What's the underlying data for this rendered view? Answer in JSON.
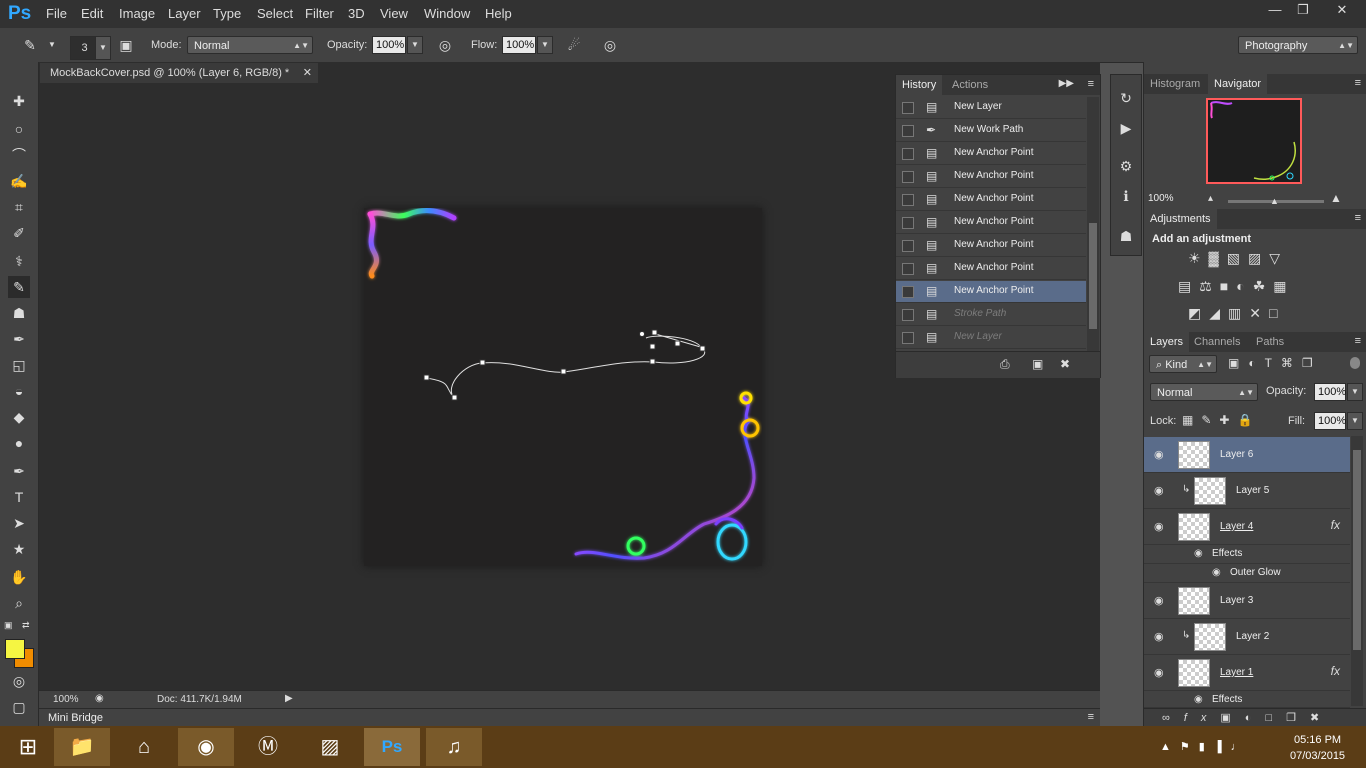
{
  "app": {
    "logo": "Ps"
  },
  "menu": [
    "File",
    "Edit",
    "Image",
    "Layer",
    "Type",
    "Select",
    "Filter",
    "3D",
    "View",
    "Window",
    "Help"
  ],
  "window_controls": {
    "minimize": "—",
    "restore": "❐",
    "close": "✕"
  },
  "options": {
    "brush_size": "3",
    "mode_label": "Mode:",
    "mode_value": "Normal",
    "opacity_label": "Opacity:",
    "opacity_value": "100%",
    "flow_label": "Flow:",
    "flow_value": "100%",
    "workspace": "Photography"
  },
  "document": {
    "tab_title": "MockBackCover.psd @ 100% (Layer 6, RGB/8) *",
    "zoom": "100%",
    "doc_info": "Doc: 411.7K/1.94M"
  },
  "mini_bridge": {
    "label": "Mini Bridge"
  },
  "history": {
    "tabs": [
      "History",
      "Actions"
    ],
    "items": [
      {
        "label": "New Layer",
        "state": "normal"
      },
      {
        "label": "New Work Path",
        "state": "normal"
      },
      {
        "label": "New Anchor Point",
        "state": "normal"
      },
      {
        "label": "New Anchor Point",
        "state": "normal"
      },
      {
        "label": "New Anchor Point",
        "state": "normal"
      },
      {
        "label": "New Anchor Point",
        "state": "normal"
      },
      {
        "label": "New Anchor Point",
        "state": "normal"
      },
      {
        "label": "New Anchor Point",
        "state": "normal"
      },
      {
        "label": "New Anchor Point",
        "state": "selected"
      },
      {
        "label": "Stroke Path",
        "state": "undone"
      },
      {
        "label": "New Layer",
        "state": "undone"
      }
    ]
  },
  "navigator": {
    "tabs": [
      "Histogram",
      "Navigator"
    ],
    "zoom": "100%"
  },
  "adjustments": {
    "tab": "Adjustments",
    "heading": "Add an adjustment"
  },
  "layers": {
    "tabs": [
      "Layers",
      "Channels",
      "Paths"
    ],
    "filter_kind": "Kind",
    "blend_mode": "Normal",
    "opacity_label": "Opacity:",
    "opacity_value": "100%",
    "lock_label": "Lock:",
    "fill_label": "Fill:",
    "fill_value": "100%",
    "items": [
      {
        "name": "Layer 6",
        "selected": true,
        "clipped": false,
        "fx": false
      },
      {
        "name": "Layer 5",
        "selected": false,
        "clipped": true,
        "fx": false
      },
      {
        "name": "Layer 4",
        "selected": false,
        "clipped": false,
        "fx": true
      },
      {
        "name": "Layer 3",
        "selected": false,
        "clipped": false,
        "fx": false
      },
      {
        "name": "Layer 2",
        "selected": false,
        "clipped": true,
        "fx": false
      },
      {
        "name": "Layer 1",
        "selected": false,
        "clipped": false,
        "fx": true
      }
    ],
    "effects_label": "Effects",
    "outer_glow_label": "Outer Glow"
  },
  "taskbar": {
    "time": "05:16 PM",
    "date": "07/03/2015",
    "colors": {
      "bg": "#5b3d16"
    }
  },
  "colors": {
    "foreground": "#f5f542",
    "background": "#f08c00",
    "selection": "#5a6c8a"
  }
}
